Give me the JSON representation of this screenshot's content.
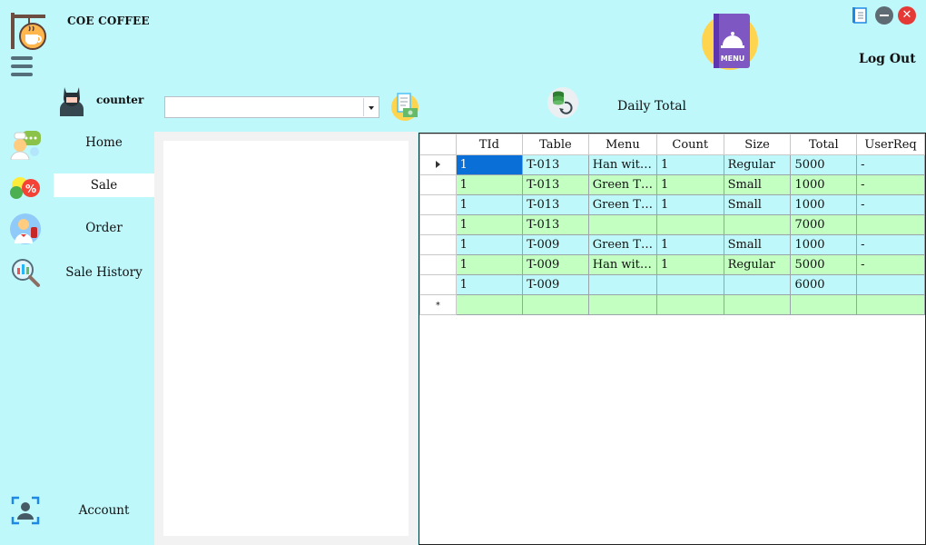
{
  "app": {
    "title": "COE COFFEE"
  },
  "header": {
    "logout_label": "Log Out"
  },
  "user": {
    "name": "counter"
  },
  "sidebar": {
    "items": [
      {
        "label": "Home",
        "icon": "chef-chat-icon"
      },
      {
        "label": "Sale",
        "icon": "discount-tag-icon",
        "active": true
      },
      {
        "label": "Order",
        "icon": "waiter-icon"
      },
      {
        "label": "Sale History",
        "icon": "analytics-magnifier-icon"
      }
    ],
    "account_label": "Account"
  },
  "toolbar": {
    "table_select_value": "",
    "daily_total_label": "Daily Total"
  },
  "grid": {
    "columns": [
      "TId",
      "Table",
      "Menu",
      "Count",
      "Size",
      "Total",
      "UserReq"
    ],
    "rows": [
      [
        "1",
        "T-013",
        "Han wit…",
        "1",
        "Regular",
        "5000",
        "-"
      ],
      [
        "1",
        "T-013",
        "Green T…",
        "1",
        "Small",
        "1000",
        "-"
      ],
      [
        "1",
        "T-013",
        "Green T…",
        "1",
        "Small",
        "1000",
        "-"
      ],
      [
        "1",
        "T-013",
        "",
        "",
        "",
        "7000",
        ""
      ],
      [
        "1",
        "T-009",
        "Green T…",
        "1",
        "Small",
        "1000",
        "-"
      ],
      [
        "1",
        "T-009",
        "Han wit…",
        "1",
        "Regular",
        "5000",
        "-"
      ],
      [
        "1",
        "T-009",
        "",
        "",
        "",
        "6000",
        ""
      ]
    ],
    "new_row_marker": "*"
  },
  "colors": {
    "background": "#bff8fb",
    "row_cyan": "#bff8fb",
    "row_green": "#c2ffc0",
    "selection": "#0a6fd6",
    "close": "#e53935"
  }
}
